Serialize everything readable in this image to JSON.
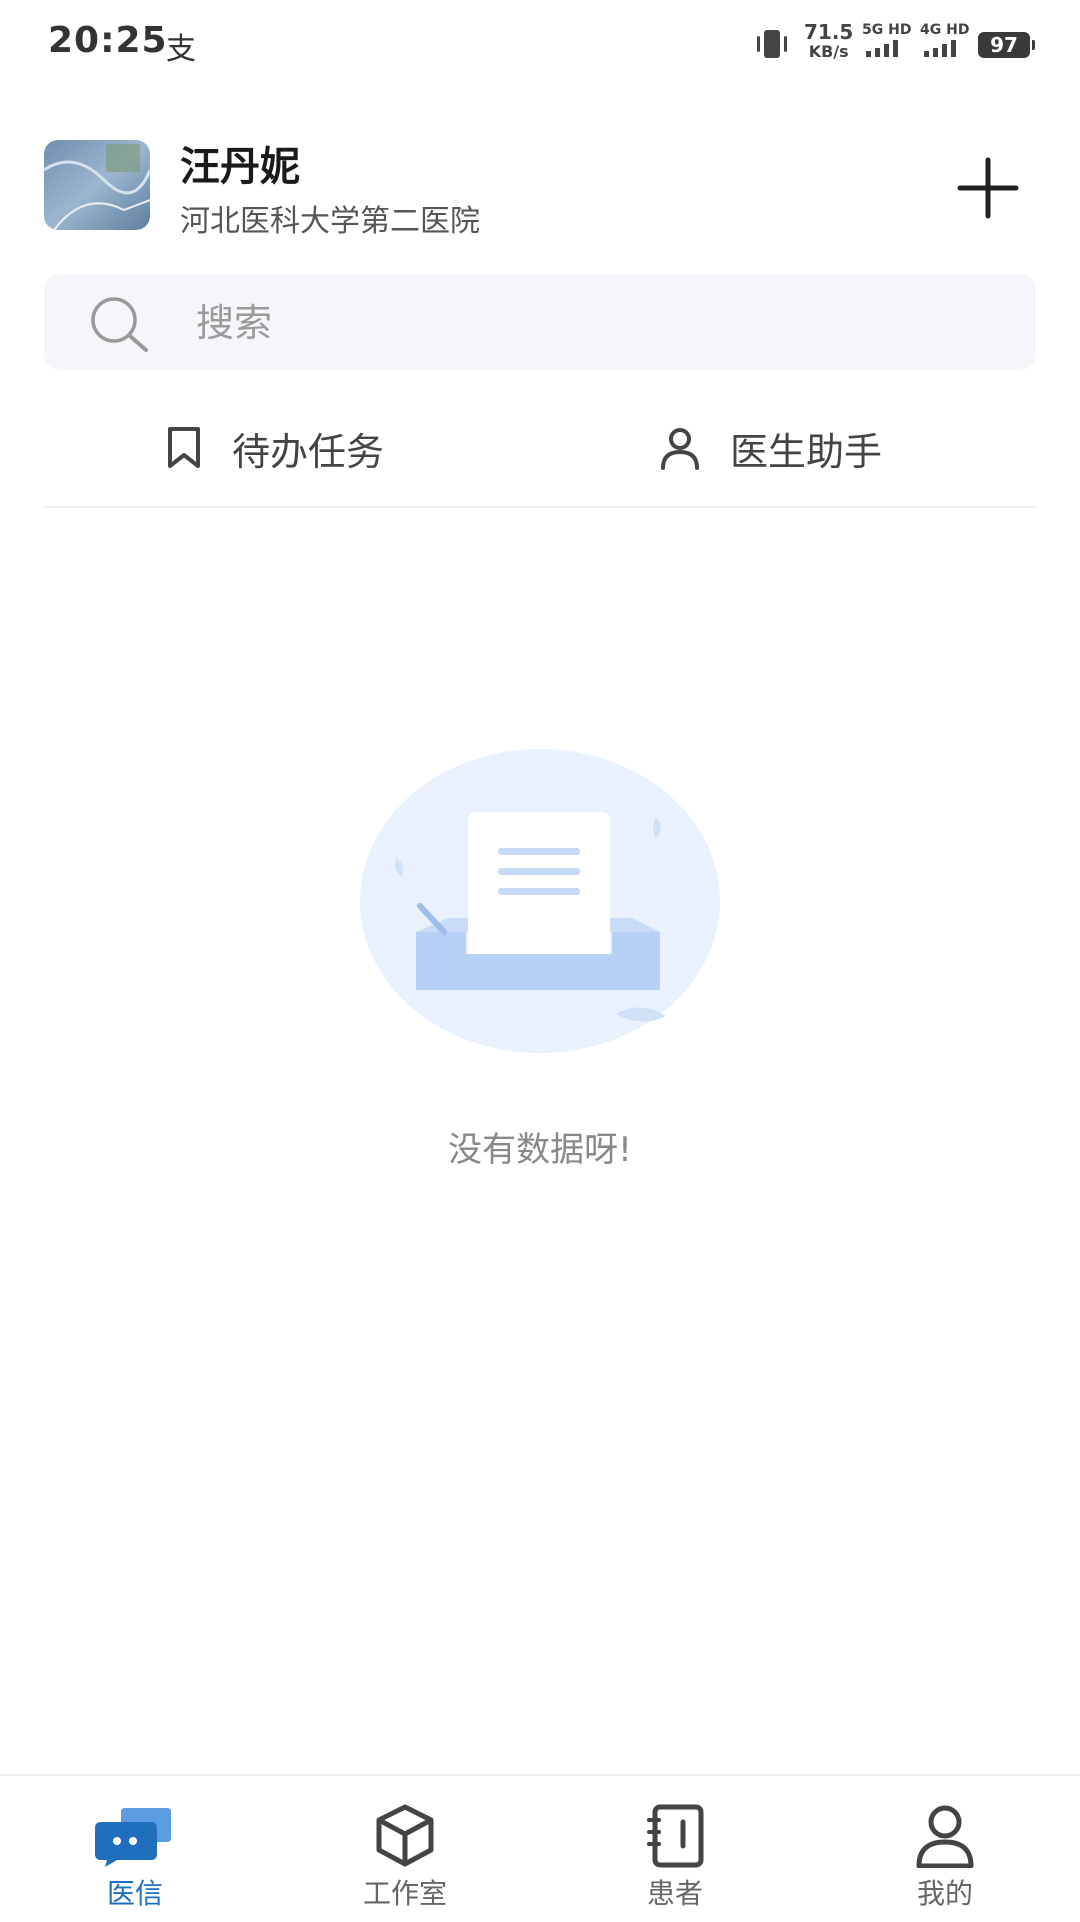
{
  "status_bar": {
    "time": "20:25",
    "alipay_glyph": "支",
    "net_speed_value": "71.5",
    "net_speed_unit": "KB/s",
    "sim1": "5G HD",
    "sim2": "4G HD",
    "battery": "97"
  },
  "header": {
    "user_name": "汪丹妮",
    "organization": "河北医科大学第二医院",
    "add_icon": "plus-icon"
  },
  "search": {
    "placeholder": "搜索"
  },
  "quick_actions": [
    {
      "label": "待办任务",
      "icon": "bookmark-icon"
    },
    {
      "label": "医生助手",
      "icon": "person-icon"
    }
  ],
  "empty_state": {
    "message": "没有数据呀!"
  },
  "bottom_nav": {
    "active_index": 0,
    "active_color": "#1f6fbd",
    "items": [
      {
        "label": "医信",
        "icon": "chat-bubbles-icon"
      },
      {
        "label": "工作室",
        "icon": "cube-icon"
      },
      {
        "label": "患者",
        "icon": "notebook-icon"
      },
      {
        "label": "我的",
        "icon": "user-icon"
      }
    ]
  }
}
